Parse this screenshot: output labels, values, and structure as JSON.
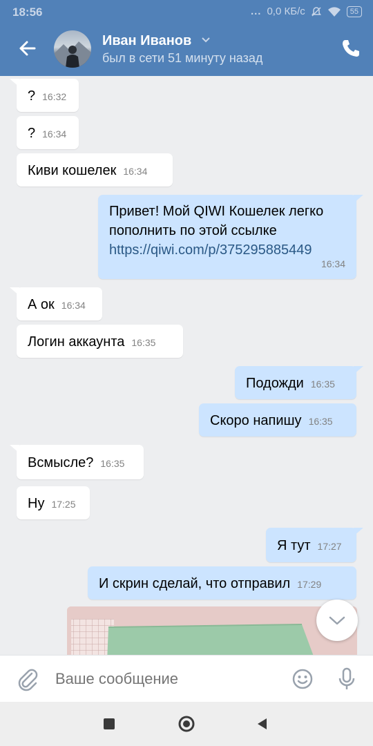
{
  "status_bar": {
    "time": "18:56",
    "dots": "...",
    "speed": "0,0 КБ/с",
    "battery": "55"
  },
  "header": {
    "name": "Иван Иванов",
    "status": "был в сети 51 минуту назад"
  },
  "messages": [
    {
      "dir": "in",
      "text": "?",
      "time": "16:32"
    },
    {
      "dir": "in",
      "text": "?",
      "time": "16:34"
    },
    {
      "dir": "in",
      "text": "Киви кошелек",
      "time": "16:34"
    },
    {
      "dir": "out",
      "line1": "Привет! Мой QIWI Кошелек легко",
      "line2": "пополнить по этой ссылке",
      "link": "https://qiwi.com/p/375295885449",
      "time": "16:34"
    },
    {
      "dir": "in",
      "text": "А ок",
      "time": "16:34"
    },
    {
      "dir": "in",
      "text": "Логин аккаунта",
      "time": "16:35"
    },
    {
      "dir": "out",
      "text": "Подожди",
      "time": "16:35"
    },
    {
      "dir": "out",
      "text": "Скоро напишу",
      "time": "16:35"
    },
    {
      "dir": "in",
      "text": "Всмысле?",
      "time": "16:35"
    },
    {
      "dir": "in",
      "text": "Ну",
      "time": "17:25"
    },
    {
      "dir": "out",
      "text": "Я тут",
      "time": "17:27"
    },
    {
      "dir": "out",
      "text": "И скрин сделай, что отправил",
      "time": "17:29"
    }
  ],
  "composer": {
    "placeholder": "Ваше сообщение"
  },
  "colors": {
    "header": "#5181b8",
    "incoming_bubble": "#ffffff",
    "outgoing_bubble": "#cce4ff",
    "background": "#edeef0",
    "link": "#2a5885"
  }
}
